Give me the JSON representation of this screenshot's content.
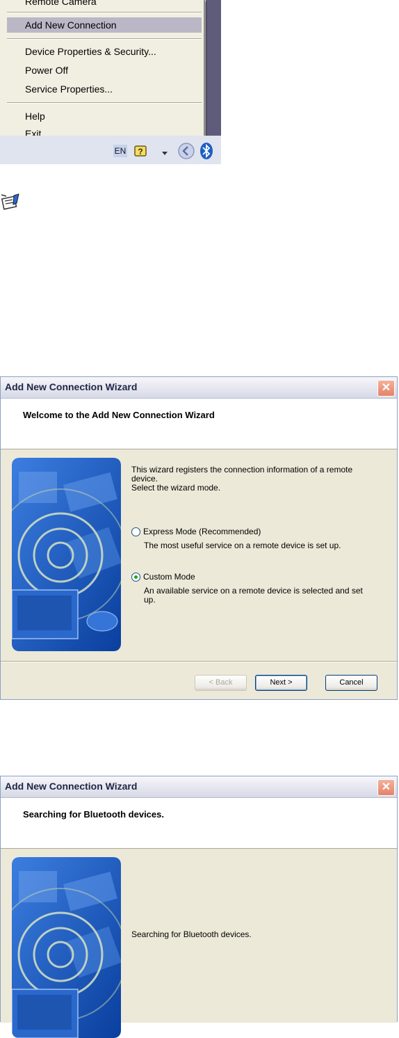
{
  "context_menu": {
    "items": [
      {
        "label": "Remote Camera",
        "partial": true
      },
      {
        "label": "Add New Connection",
        "highlighted": true
      },
      {
        "label": "Device Properties & Security..."
      },
      {
        "label": "Power Off"
      },
      {
        "label": "Service Properties..."
      },
      {
        "label": "Help"
      },
      {
        "label": "Exit"
      }
    ]
  },
  "taskbar": {
    "language": "EN",
    "icons": [
      "help-icon",
      "chevron-down-icon",
      "show-hidden-icon",
      "bluetooth-icon"
    ]
  },
  "note_icon": "note-icon",
  "wizard1": {
    "title": "Add New Connection Wizard",
    "header": "Welcome to the Add New Connection Wizard",
    "intro_line1": "This wizard registers the connection information of a remote",
    "intro_line2": "device.",
    "intro_line3": "Select the wizard mode.",
    "option_express": {
      "label": "Express Mode (Recommended)",
      "description": "The most useful service on a remote device is set up.",
      "selected": false
    },
    "option_custom": {
      "label": "Custom Mode",
      "description_line1": "An available service on a remote device is selected and set",
      "description_line2": "up.",
      "selected": true
    },
    "buttons": {
      "back": "< Back",
      "next": "Next >",
      "cancel": "Cancel"
    }
  },
  "wizard2": {
    "title": "Add New Connection Wizard",
    "header": "Searching for Bluetooth devices.",
    "status": "Searching for Bluetooth devices."
  },
  "colors": {
    "highlight": "#bbb7c7",
    "art_blue": "#1f5fc4",
    "window_face": "#ece9d8"
  }
}
